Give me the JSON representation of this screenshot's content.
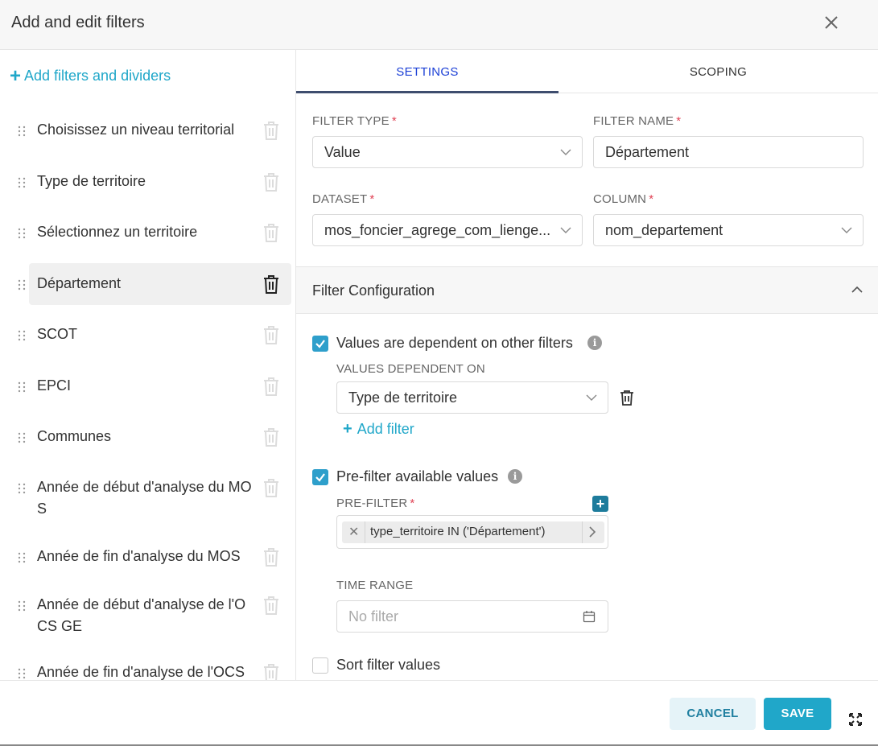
{
  "modal": {
    "title": "Add and edit filters"
  },
  "sidebar": {
    "add_label": "Add filters and dividers",
    "items": [
      {
        "label": "Choisissez un niveau territorial"
      },
      {
        "label": "Type de territoire"
      },
      {
        "label": "Sélectionnez un territoire"
      },
      {
        "label": "Département"
      },
      {
        "label": "SCOT"
      },
      {
        "label": "EPCI"
      },
      {
        "label": "Communes"
      },
      {
        "label": "Année de début d'analyse du MO S"
      },
      {
        "label": "Année de fin d'analyse du MOS"
      },
      {
        "label": "Année de début d'analyse de l'O CS GE"
      },
      {
        "label": "Année de fin d'analyse de l'OCS"
      }
    ]
  },
  "tabs": {
    "settings": "SETTINGS",
    "scoping": "SCOPING"
  },
  "settings": {
    "filter_type": {
      "label": "FILTER TYPE",
      "value": "Value"
    },
    "filter_name": {
      "label": "FILTER NAME",
      "value": "Département"
    },
    "dataset": {
      "label": "DATASET",
      "value": "mos_foncier_agrege_com_lienge..."
    },
    "column": {
      "label": "COLUMN",
      "value": "nom_departement"
    },
    "required_mark": "*"
  },
  "config": {
    "title": "Filter Configuration",
    "dependent": {
      "label": "Values are dependent on other filters",
      "checked": true,
      "sub_label": "VALUES DEPENDENT ON",
      "value": "Type de territoire",
      "add_filter": "Add filter"
    },
    "prefilter": {
      "label": "Pre-filter available values",
      "checked": true,
      "sub_label": "PRE-FILTER",
      "pill": "type_territoire IN ('Département')",
      "time_range_label": "TIME RANGE",
      "time_range_placeholder": "No filter"
    },
    "sort": {
      "label": "Sort filter values",
      "checked": false
    }
  },
  "footer": {
    "cancel": "CANCEL",
    "save": "SAVE"
  },
  "colors": {
    "accent": "#20a7c9",
    "tab_active": "#1b3fd6",
    "required": "#e04355",
    "checkbox": "#2e9fcb"
  }
}
